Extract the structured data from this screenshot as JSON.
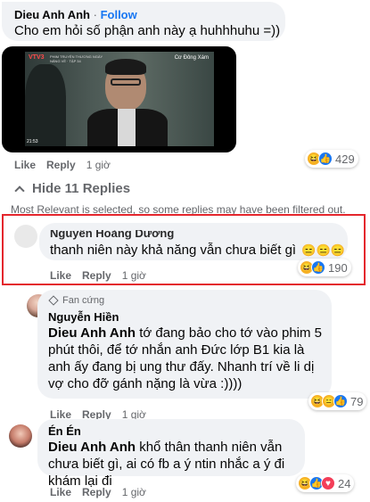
{
  "comment1": {
    "name": "Dieu Anh Anh",
    "separator": "·",
    "follow": "Follow",
    "text": "Cho em hỏi số phận anh này ạ huhhhuhu =))",
    "video": {
      "channel": "VTV3",
      "corner_text": "Cơ Đông Xám",
      "time": "21:53",
      "caption": "PHIM TRUYỆN THƯƠNG NGÀY NẮNG VỀ · TẬP 34"
    },
    "like": "Like",
    "reply": "Reply",
    "time": "1 giờ",
    "reaction_count": "429"
  },
  "replies_toggle": {
    "label": "Hide 11 Replies"
  },
  "filter_notice": "Most Relevant is selected, so some replies may have been filtered out.",
  "reply1": {
    "name": "Nguyễn Hoàng Dương",
    "text": "thanh niên này khả năng vẫn chưa biết gì",
    "emojis": "😑😑😑",
    "like": "Like",
    "reply": "Reply",
    "time": "1 giờ",
    "reaction_count": "190",
    "highlight_color": "#e4262d"
  },
  "reply2": {
    "badge": "Fan cứng",
    "name": "Nguyễn Hiền",
    "mention": "Dieu Anh Anh",
    "text": " tớ đang bảo cho tớ vào phim 5 phút thôi, để tớ nhắn anh Đức lớp B1 kia là anh ấy đang bị ung thư đấy. Nhanh trí về li dị vợ cho đỡ gánh nặng là vừa :))))",
    "like": "Like",
    "reply": "Reply",
    "time": "1 giờ",
    "reaction_count": "79"
  },
  "reply3": {
    "name": "Én Én",
    "mention": "Dieu Anh Anh",
    "text": " khổ thân thanh niên vẫn chưa biết gì, ai có fb a ý ntin nhắc a ý đi khám lại đi",
    "like": "Like",
    "reply": "Reply",
    "time": "1 giờ",
    "reaction_count": "24"
  },
  "colors": {
    "link": "#1877f2",
    "muted": "#65676b",
    "bubble": "#f0f2f5"
  }
}
